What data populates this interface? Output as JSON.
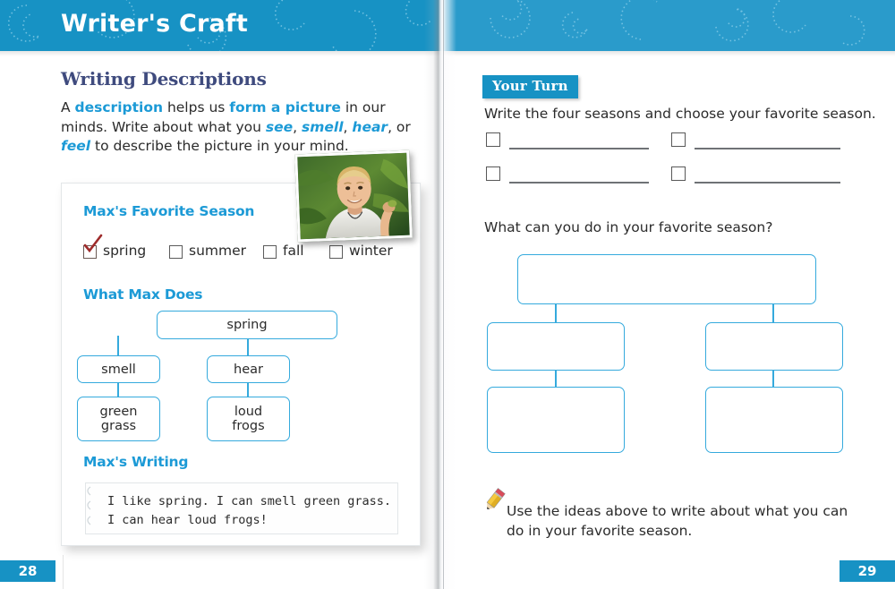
{
  "header": {
    "title": "Writer's Craft",
    "band_color": "#1792c4"
  },
  "left_page": {
    "page_number": "28",
    "section_title": "Writing Descriptions",
    "intro": {
      "part1": "A ",
      "kw1": "description",
      "part2": " helps us ",
      "kw2": "form a picture",
      "part3": " in our minds. Write about what you ",
      "kw3": "see",
      "sep1": ", ",
      "kw4": "smell",
      "sep2": ", ",
      "kw5": "hear",
      "sep3": ", or ",
      "kw6": "feel",
      "part4": " to describe the picture in your mind."
    },
    "photo_alt": "boy-in-white-shirt-outdoors-photo",
    "model": {
      "heading_season": "Max's Favorite Season",
      "seasons": [
        {
          "label": "spring",
          "checked": true
        },
        {
          "label": "summer",
          "checked": false
        },
        {
          "label": "fall",
          "checked": false
        },
        {
          "label": "winter",
          "checked": false
        }
      ],
      "heading_does": "What Max Does",
      "flowchart": {
        "root": "spring",
        "branches": [
          {
            "middle": "smell",
            "leaf": "green\ngrass"
          },
          {
            "middle": "hear",
            "leaf": "loud\nfrogs"
          }
        ]
      },
      "heading_writing": "Max's Writing",
      "writing_sample": "I like spring. I can smell green grass.\nI can hear loud frogs!"
    }
  },
  "right_page": {
    "page_number": "29",
    "badge": "Your Turn",
    "prompt_seasons": "Write the four seasons and choose your favorite season.",
    "answer_rows": [
      {
        "box": "checkbox",
        "line": "blank"
      },
      {
        "box": "checkbox",
        "line": "blank"
      },
      {
        "box": "checkbox",
        "line": "blank"
      },
      {
        "box": "checkbox",
        "line": "blank"
      }
    ],
    "prompt_activity": "What can you do in your favorite season?",
    "blank_flowchart": {
      "root": "",
      "branches": [
        {
          "middle": "",
          "leaf": ""
        },
        {
          "middle": "",
          "leaf": ""
        }
      ]
    },
    "task_instruction": "Use the ideas above to write about what you can do in your favorite season.",
    "pencil_icon": "pencil-icon"
  },
  "colors": {
    "brand_blue": "#1792c4",
    "accent_blue": "#1c9ad6",
    "box_outline": "#35aadd",
    "heading_navy": "#3f4b7e",
    "body_text": "#2b2b2b",
    "check_red": "#9e2b2b"
  }
}
